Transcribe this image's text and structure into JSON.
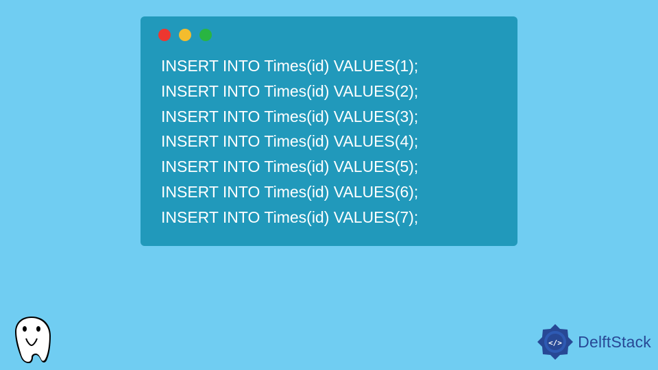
{
  "code": {
    "lines": [
      "INSERT INTO Times(id) VALUES(1);",
      "INSERT INTO Times(id) VALUES(2);",
      "INSERT INTO Times(id) VALUES(3);",
      "INSERT INTO Times(id) VALUES(4);",
      "INSERT INTO Times(id) VALUES(5);",
      "INSERT INTO Times(id) VALUES(6);",
      "INSERT INTO Times(id) VALUES(7);"
    ]
  },
  "brand": {
    "name": "DelftStack"
  }
}
